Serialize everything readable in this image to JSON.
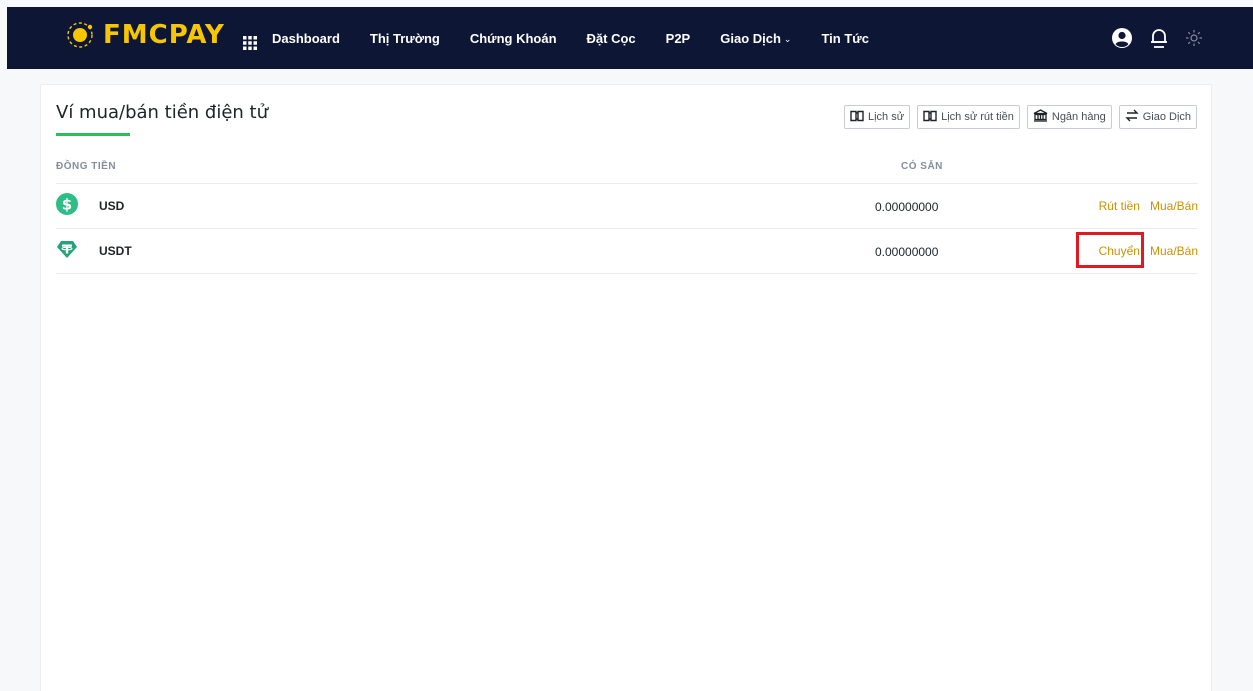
{
  "brand": {
    "name": "FMCPAY",
    "logo_color": "#f7c600"
  },
  "nav": {
    "items": [
      {
        "label": "Dashboard"
      },
      {
        "label": "Thị Trường"
      },
      {
        "label": "Chứng Khoán"
      },
      {
        "label": "Đặt Cọc"
      },
      {
        "label": "P2P"
      },
      {
        "label": "Giao Dịch",
        "has_dropdown": true
      },
      {
        "label": "Tin Tức"
      }
    ],
    "right_icons": [
      "user-icon",
      "bell-icon",
      "sun-icon"
    ]
  },
  "wallet": {
    "title": "Ví mua/bán tiền điện tử",
    "actions": [
      {
        "label": "Lịch sử",
        "icon": "book-icon"
      },
      {
        "label": "Lịch sử rút tiền",
        "icon": "book-icon"
      },
      {
        "label": "Ngân hàng",
        "icon": "bank-icon"
      },
      {
        "label": "Giao Dịch",
        "icon": "swap-icon"
      }
    ],
    "columns": {
      "coin": "ĐỒNG TIỀN",
      "available": "CÓ SẴN"
    },
    "rows": [
      {
        "coin": "USD",
        "icon": "dollar-icon",
        "available": "0.00000000",
        "action1": "Rút tiền",
        "action2": "Mua/Bán"
      },
      {
        "coin": "USDT",
        "icon": "tether-icon",
        "available": "0.00000000",
        "action1": "Chuyển",
        "action2": "Mua/Bán",
        "highlighted": true
      }
    ]
  },
  "colors": {
    "navbar_bg": "#0e1636",
    "accent_gold": "#c99400",
    "accent_green": "#2ebd58",
    "highlight_red": "#e01a22"
  }
}
